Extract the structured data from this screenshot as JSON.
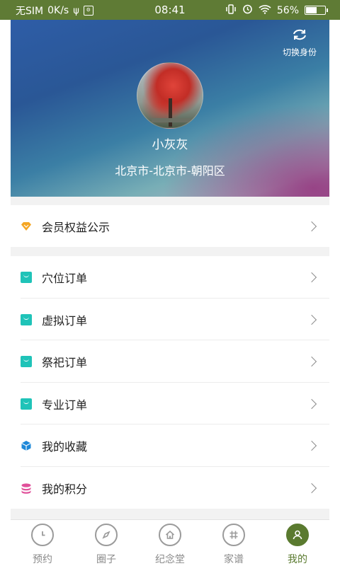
{
  "status_bar": {
    "carrier": "无SIM",
    "speed": "0K/s",
    "time": "08:41",
    "battery": "56%"
  },
  "header": {
    "switch_label": "切换身份",
    "username": "小灰灰",
    "location": "北京市-北京市-朝阳区"
  },
  "menu": {
    "membership": {
      "label": "会员权益公示",
      "icon": "diamond-icon"
    },
    "items": [
      {
        "label": "穴位订单",
        "icon": "shopping-bag-icon"
      },
      {
        "label": "虚拟订单",
        "icon": "shopping-bag-icon"
      },
      {
        "label": "祭祀订单",
        "icon": "shopping-bag-icon"
      },
      {
        "label": "专业订单",
        "icon": "shopping-bag-icon"
      },
      {
        "label": "我的收藏",
        "icon": "cube-icon"
      },
      {
        "label": "我的积分",
        "icon": "coins-icon"
      }
    ]
  },
  "nav": {
    "items": [
      {
        "label": "预约",
        "icon": "clock-icon"
      },
      {
        "label": "圈子",
        "icon": "compass-icon"
      },
      {
        "label": "纪念堂",
        "icon": "home-icon"
      },
      {
        "label": "家谱",
        "icon": "grid-icon"
      },
      {
        "label": "我的",
        "icon": "user-icon",
        "active": true
      }
    ]
  },
  "colors": {
    "status_bar": "#5f7b35",
    "accent": "#5a7a2f",
    "bag_icon": "#1fc3b8",
    "diamond_icon": "#f5a623",
    "cube_icon": "#1e88d8",
    "coins_icon": "#e0509a"
  }
}
